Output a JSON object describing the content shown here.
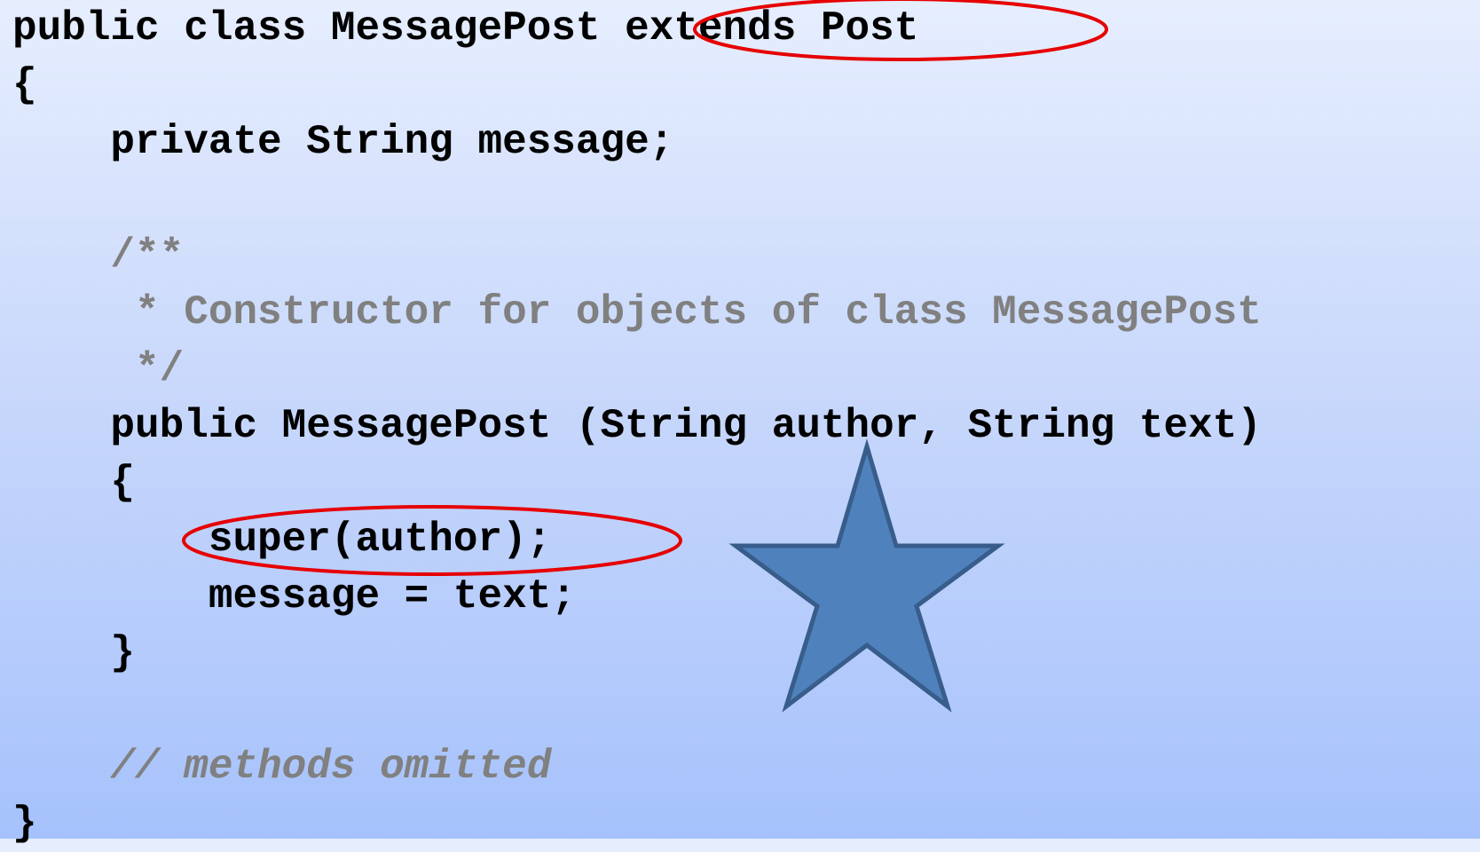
{
  "code": {
    "lines": [
      "public class MessagePost extends Post",
      "{",
      "    private String message;",
      "",
      "    /**",
      "     * Constructor for objects of class MessagePost",
      "     */",
      "    public MessagePost (String author, String text)",
      "    {",
      "        super(author);",
      "        message = text;",
      "    }",
      "",
      "    // methods omitted",
      "}"
    ]
  },
  "colors": {
    "code_text": "#000000",
    "comment_text": "#808080",
    "highlight_ellipse": "#e60000",
    "star_fill": "#4f81bd",
    "star_stroke": "#385d8a",
    "background_top": "#e6eefe",
    "background_bottom": "#a6c2fc"
  },
  "annotations": {
    "highlights": [
      "extends Post",
      "super(author);"
    ],
    "shape": "star-icon"
  }
}
